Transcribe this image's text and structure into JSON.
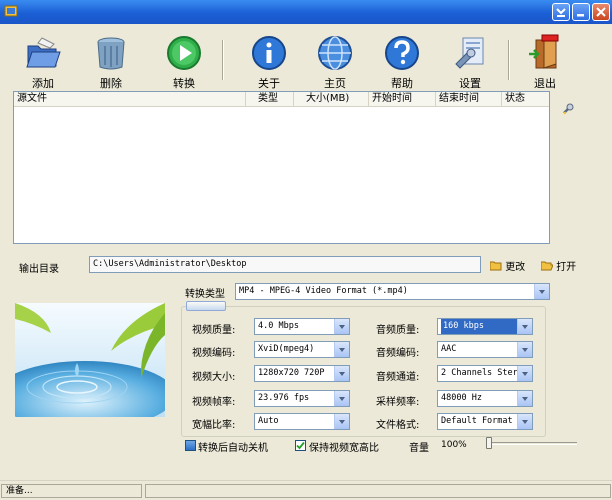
{
  "window": {
    "title": ""
  },
  "toolbar": {
    "add": "添加",
    "delete": "删除",
    "convert": "转换",
    "about": "关于",
    "homepage": "主页",
    "help": "帮助",
    "settings": "设置",
    "exit": "退出"
  },
  "filelist": {
    "columns": [
      "源文件",
      "类型",
      "大小(MB)",
      "开始时间",
      "结束时间",
      "状态"
    ],
    "rows": []
  },
  "output": {
    "label": "输出目录",
    "path": "C:\\Users\\Administrator\\Desktop",
    "change": "更改",
    "open": "打开"
  },
  "convert_type": {
    "label": "转换类型",
    "value": "MP4 - MPEG-4 Video Format (*.mp4)"
  },
  "video": {
    "quality_label": "视频质量:",
    "quality": "4.0 Mbps",
    "codec_label": "视频编码:",
    "codec": "XviD(mpeg4)",
    "size_label": "视频大小:",
    "size": "1280x720 720P",
    "fps_label": "视频帧率:",
    "fps": "23.976 fps",
    "aspect_label": "宽幅比率:",
    "aspect": "Auto"
  },
  "audio": {
    "quality_label": "音频质量:",
    "quality": "160 kbps",
    "codec_label": "音频编码:",
    "codec": "AAC",
    "channels_label": "音频通道:",
    "channels": "2 Channels Stere",
    "samplerate_label": "采样频率:",
    "samplerate": "48000 Hz",
    "format_label": "文件格式:",
    "format": "Default Format"
  },
  "options": {
    "auto_shutdown": "转换后自动关机",
    "auto_shutdown_checked": false,
    "keep_aspect": "保持视频宽高比",
    "keep_aspect_checked": true
  },
  "volume": {
    "label": "音量",
    "value_text": "100%",
    "level": 1.0
  },
  "status": {
    "text": "准备..."
  },
  "colors": {
    "titlebar": "#1b5fd6",
    "background": "#ece9d8",
    "selection": "#316ac5"
  },
  "icons": {
    "add": "open-folder-icon",
    "delete": "trash-can-icon",
    "convert": "play-icon",
    "about": "info-icon",
    "homepage": "globe-icon",
    "help": "question-icon",
    "settings": "settings-icon",
    "exit": "exit-door-icon"
  }
}
